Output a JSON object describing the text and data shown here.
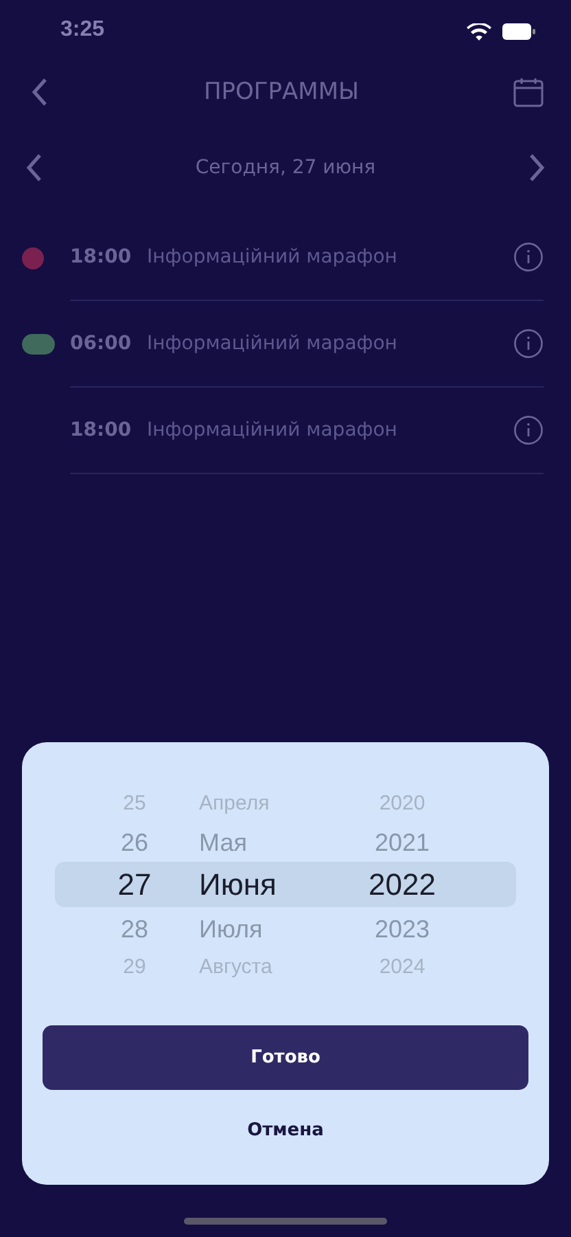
{
  "status_bar": {
    "time": "3:25"
  },
  "header": {
    "title": "ПРОГРАММЫ"
  },
  "date_nav": {
    "label": "Сегодня, 27 июня"
  },
  "programs": [
    {
      "time": "18:00",
      "title": "Інформаційний марафон",
      "kind": "dot",
      "color": "#7a2150"
    },
    {
      "time": "06:00",
      "title": "Інформаційний марафон",
      "kind": "pill",
      "color": "#3f6a5c"
    },
    {
      "time": "18:00",
      "title": "Інформаційний марафон",
      "kind": "none"
    }
  ],
  "picker": {
    "columns": [
      {
        "items": [
          {
            "label": "25",
            "selected": false
          },
          {
            "label": "26",
            "selected": false
          },
          {
            "label": "27",
            "selected": true
          },
          {
            "label": "28",
            "selected": false
          },
          {
            "label": "29",
            "selected": false
          }
        ]
      },
      {
        "items": [
          {
            "label": "Апреля",
            "selected": false
          },
          {
            "label": "Мая",
            "selected": false
          },
          {
            "label": "Июня",
            "selected": true
          },
          {
            "label": "Июля",
            "selected": false
          },
          {
            "label": "Августа",
            "selected": false
          }
        ]
      },
      {
        "items": [
          {
            "label": "2020",
            "selected": false
          },
          {
            "label": "2021",
            "selected": false
          },
          {
            "label": "2022",
            "selected": true
          },
          {
            "label": "2023",
            "selected": false
          },
          {
            "label": "2024",
            "selected": false
          }
        ]
      }
    ]
  },
  "buttons": {
    "confirm": "Готово",
    "cancel": "Отмена"
  }
}
